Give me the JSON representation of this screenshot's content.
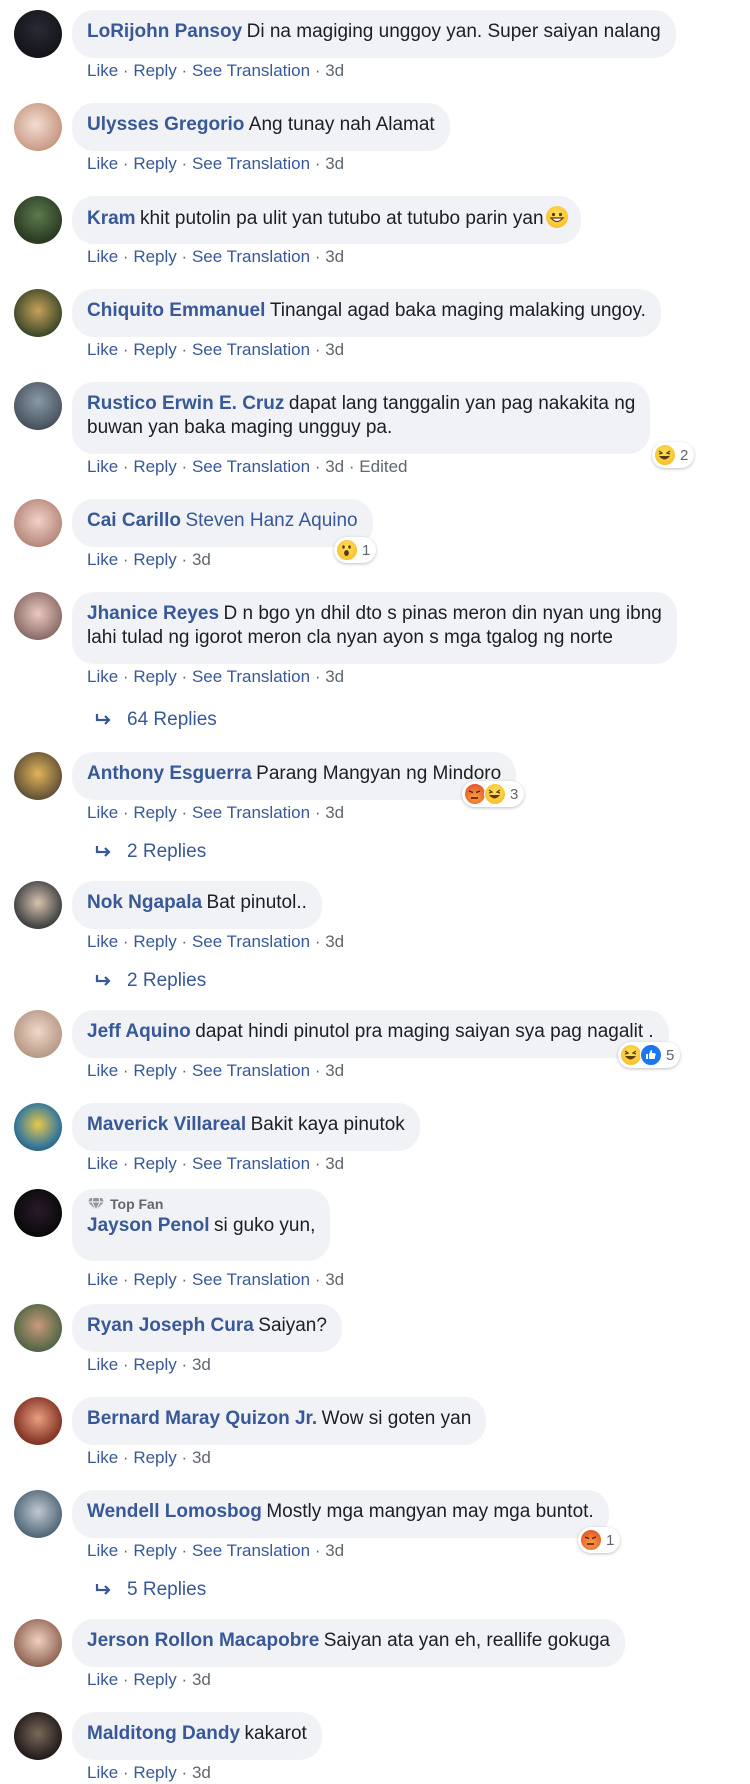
{
  "labels": {
    "like": "Like",
    "reply": "Reply",
    "see_translation": "See Translation",
    "sep": "·",
    "edited": "Edited",
    "top_fan": "Top Fan"
  },
  "comments": [
    {
      "name": "LoRijohn Pansoy",
      "text": "Di na magiging unggoy yan. Super saiyan nalang",
      "time": "3d"
    },
    {
      "name": "Ulysses Gregorio",
      "text": "Ang tunay nah Alamat",
      "time": "3d"
    },
    {
      "name": "Kram",
      "text": "khit putolin pa ulit yan tutubo at tutubo parin yan",
      "time": "3d"
    },
    {
      "name": "Chiquito Emmanuel",
      "text": "Tinangal agad baka maging malaking ungoy.",
      "time": "3d"
    },
    {
      "name": "Rustico Erwin E. Cruz",
      "text": "dapat lang tanggalin yan pag nakakita ng",
      "text2": "buwan yan baka maging ungguy pa.",
      "time": "3d",
      "reactions": {
        "count": "2"
      }
    },
    {
      "name": "Cai Carillo",
      "tag": "Steven Hanz Aquino",
      "time": "3d",
      "reactions": {
        "count": "1"
      }
    },
    {
      "name": "Jhanice Reyes",
      "text": "D n bgo yn dhil dto s pinas meron din nyan ung ibng",
      "text2": "lahi tulad ng igorot meron cla nyan ayon s mga tgalog ng norte",
      "time": "3d",
      "replies": "64 Replies"
    },
    {
      "name": "Anthony Esguerra",
      "text": "Parang Mangyan ng Mindoro",
      "time": "3d",
      "reactions": {
        "count": "3"
      },
      "replies": "2 Replies"
    },
    {
      "name": "Nok Ngapala",
      "text": "Bat pinutol..",
      "time": "3d",
      "replies": "2 Replies"
    },
    {
      "name": "Jeff Aquino",
      "text": "dapat hindi pinutol pra maging saiyan sya pag nagalit .",
      "time": "3d",
      "reactions": {
        "count": "5"
      }
    },
    {
      "name": "Maverick Villareal",
      "text": "Bakit kaya pinutok",
      "time": "3d"
    },
    {
      "name": "Jayson Penol",
      "text": "si guko yun,",
      "time": "3d"
    },
    {
      "name": "Ryan Joseph Cura",
      "text": "Saiyan?",
      "time": "3d"
    },
    {
      "name": "Bernard Maray Quizon Jr.",
      "text": "Wow si goten yan",
      "time": "3d"
    },
    {
      "name": "Wendell Lomosbog",
      "text": "Mostly mga mangyan may mga buntot.",
      "time": "3d",
      "reactions": {
        "count": "1"
      },
      "replies": "5 Replies"
    },
    {
      "name": "Jerson Rollon Macapobre",
      "text": "Saiyan ata yan eh, reallife gokuga",
      "time": "3d"
    },
    {
      "name": "Malditong Dandy",
      "text": "kakarot",
      "time": "3d"
    }
  ],
  "colors": {
    "link": "#385898",
    "muted": "#606770",
    "bubble": "#f0f2f5"
  }
}
